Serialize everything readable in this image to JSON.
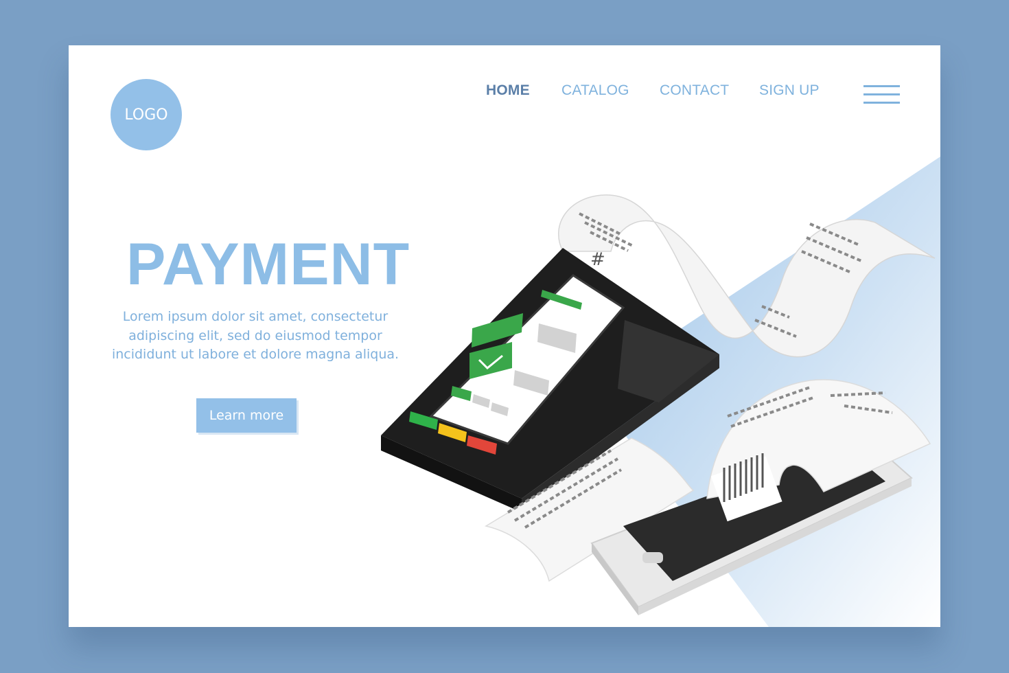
{
  "logo": {
    "text": "LOGO"
  },
  "nav": {
    "items": [
      {
        "label": "HOME",
        "active": true
      },
      {
        "label": "CATALOG",
        "active": false
      },
      {
        "label": "CONTACT",
        "active": false
      },
      {
        "label": "SIGN UP",
        "active": false
      }
    ],
    "menu_icon": "hamburger-menu-icon"
  },
  "hero": {
    "title": "PAYMENT",
    "text": "Lorem ipsum dolor sit amet, consectetur adipiscing elit, sed do eiusmod tempor incididunt ut labore et dolore magna aliqua.",
    "button_label": "Learn more"
  },
  "illustration": {
    "terminal_screen_symbol": "#",
    "icons": [
      "pos-terminal-icon",
      "smartphone-icon",
      "receipt-icon",
      "check-icon"
    ]
  },
  "colors": {
    "page_background": "#7a9fc5",
    "accent": "#93c0e8",
    "nav_active": "#5b7fa8",
    "nav_inactive": "#7fb2dd",
    "terminal_body": "#2a2a2a",
    "screen_green": "#3aa74a",
    "key_green": "#2fb24a",
    "key_yellow": "#f4c21c",
    "key_red": "#e2463a"
  }
}
